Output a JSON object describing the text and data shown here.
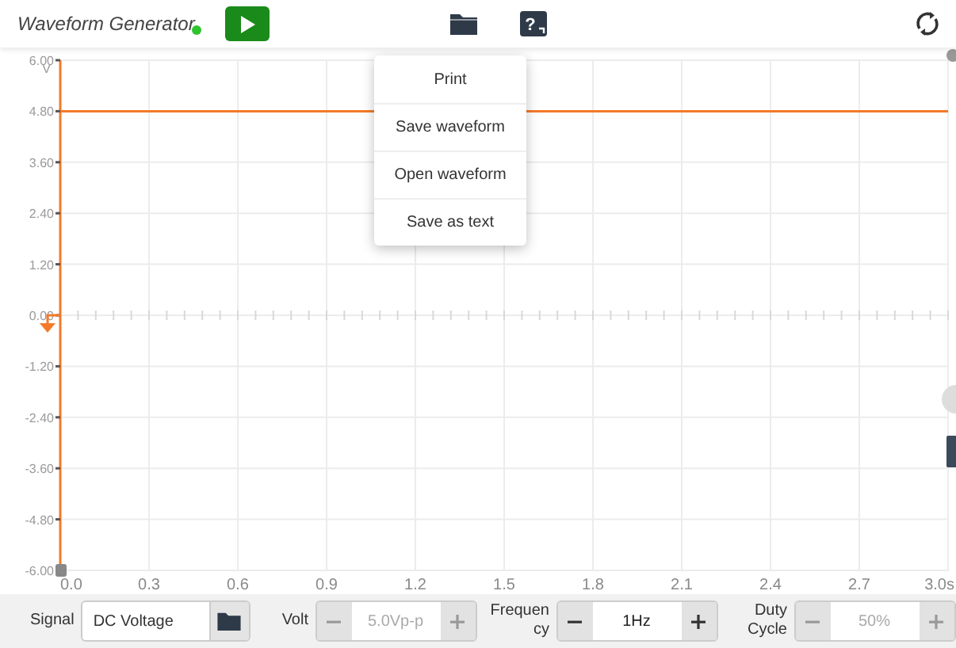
{
  "toolbar": {
    "title": "Waveform Generator",
    "connected": true,
    "running": false,
    "help_symbol": "?"
  },
  "menu": {
    "items": [
      {
        "label": "Print"
      },
      {
        "label": "Save waveform"
      },
      {
        "label": "Open waveform"
      },
      {
        "label": "Save as text"
      }
    ]
  },
  "scope": {
    "chart_data": {
      "type": "line",
      "ylabel": "V",
      "x": [
        0,
        3
      ],
      "grid": true,
      "series": [
        {
          "color": "#f47a2a",
          "values": [
            4.8,
            4.8
          ]
        }
      ],
      "xlim": [
        0,
        3
      ],
      "ylim": [
        -6,
        6
      ],
      "xticks": [
        {
          "value": 0,
          "label": "0.0"
        },
        {
          "value": 0.3,
          "label": "0.3"
        },
        {
          "value": 0.6,
          "label": "0.6"
        },
        {
          "value": 0.9,
          "label": "0.9"
        },
        {
          "value": 1.2,
          "label": "1.2"
        },
        {
          "value": 1.5,
          "label": "1.5"
        },
        {
          "value": 1.8,
          "label": "1.8"
        },
        {
          "value": 2.1,
          "label": "2.1"
        },
        {
          "value": 2.4,
          "label": "2.4"
        },
        {
          "value": 2.7,
          "label": "2.7"
        },
        {
          "value": 3,
          "label": "3.0s"
        }
      ],
      "yticks": [
        {
          "value": 6,
          "label": "6.00"
        },
        {
          "value": 4.8,
          "label": "4.80"
        },
        {
          "value": 3.6,
          "label": "3.60"
        },
        {
          "value": 2.4,
          "label": "2.40"
        },
        {
          "value": 1.2,
          "label": "1.20"
        },
        {
          "value": 0,
          "label": "0.00"
        },
        {
          "value": -1.2,
          "label": "-1.20"
        },
        {
          "value": -2.4,
          "label": "-2.40"
        },
        {
          "value": -3.6,
          "label": "-3.60"
        },
        {
          "value": -4.8,
          "label": "-4.80"
        },
        {
          "value": -6,
          "label": "-6.00"
        }
      ]
    }
  },
  "controls": {
    "signal": {
      "label": "Signal",
      "value": "DC Voltage"
    },
    "steppers": [
      {
        "label": "Volt",
        "value": "5.0Vp-p",
        "disabled": true
      },
      {
        "label": "Frequency",
        "value": "1Hz",
        "disabled": false
      },
      {
        "label": "Duty Cycle",
        "value": "50%",
        "disabled": true
      }
    ]
  }
}
